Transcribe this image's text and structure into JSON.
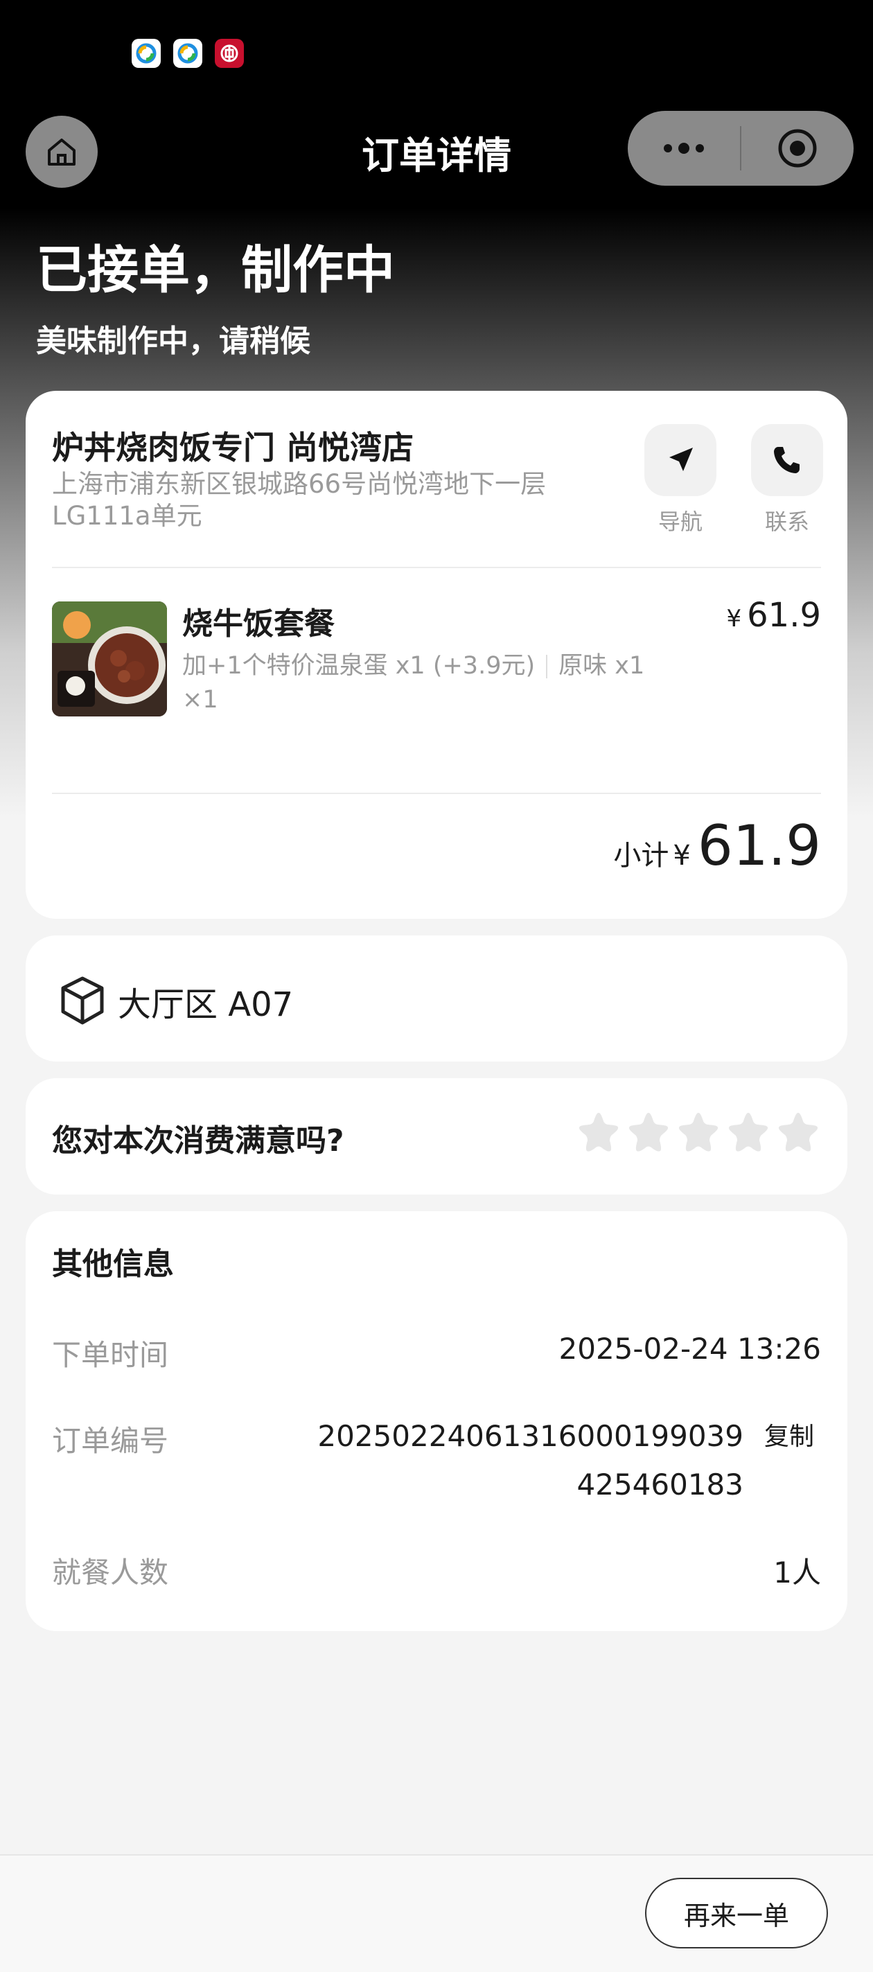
{
  "nav": {
    "title": "订单详情"
  },
  "status": {
    "title": "已接单，制作中",
    "subtitle": "美味制作中，请稍候"
  },
  "store": {
    "name": "炉丼烧肉饭专门 尚悦湾店",
    "address": "上海市浦东新区银城路66号尚悦湾地下一层LG111a单元",
    "actions": [
      {
        "label": "导航",
        "icon": "navigation-arrow-icon"
      },
      {
        "label": "联系",
        "icon": "phone-icon"
      }
    ]
  },
  "item": {
    "name": "烧牛饭套餐",
    "currency": "¥",
    "price": "61.9",
    "option_1": "加+1个特价温泉蛋 x1 (+3.9元)",
    "option_2": "原味 x1",
    "quantity": "×1"
  },
  "subtotal": {
    "label": "小计",
    "currency": "¥",
    "value": "61.9"
  },
  "table": {
    "icon": "box-icon",
    "text": "大厅区 A07"
  },
  "rating": {
    "question": "您对本次消费满意吗?",
    "max": 5,
    "value": 0
  },
  "info": {
    "title": "其他信息",
    "order_time_label": "下单时间",
    "order_time": "2025-02-24 13:26",
    "order_no_label": "订单编号",
    "order_no": "20250224061316000199039425460183",
    "copy_label": "复制",
    "diners_label": "就餐人数",
    "diners": "1人"
  },
  "bottom": {
    "reorder_label": "再来一单"
  },
  "colors": {
    "header_bg": "#000000",
    "page_bg": "#f4f4f4",
    "card_bg": "#ffffff",
    "muted_text": "#9a9a9a",
    "star_empty": "#e6e6e6"
  }
}
